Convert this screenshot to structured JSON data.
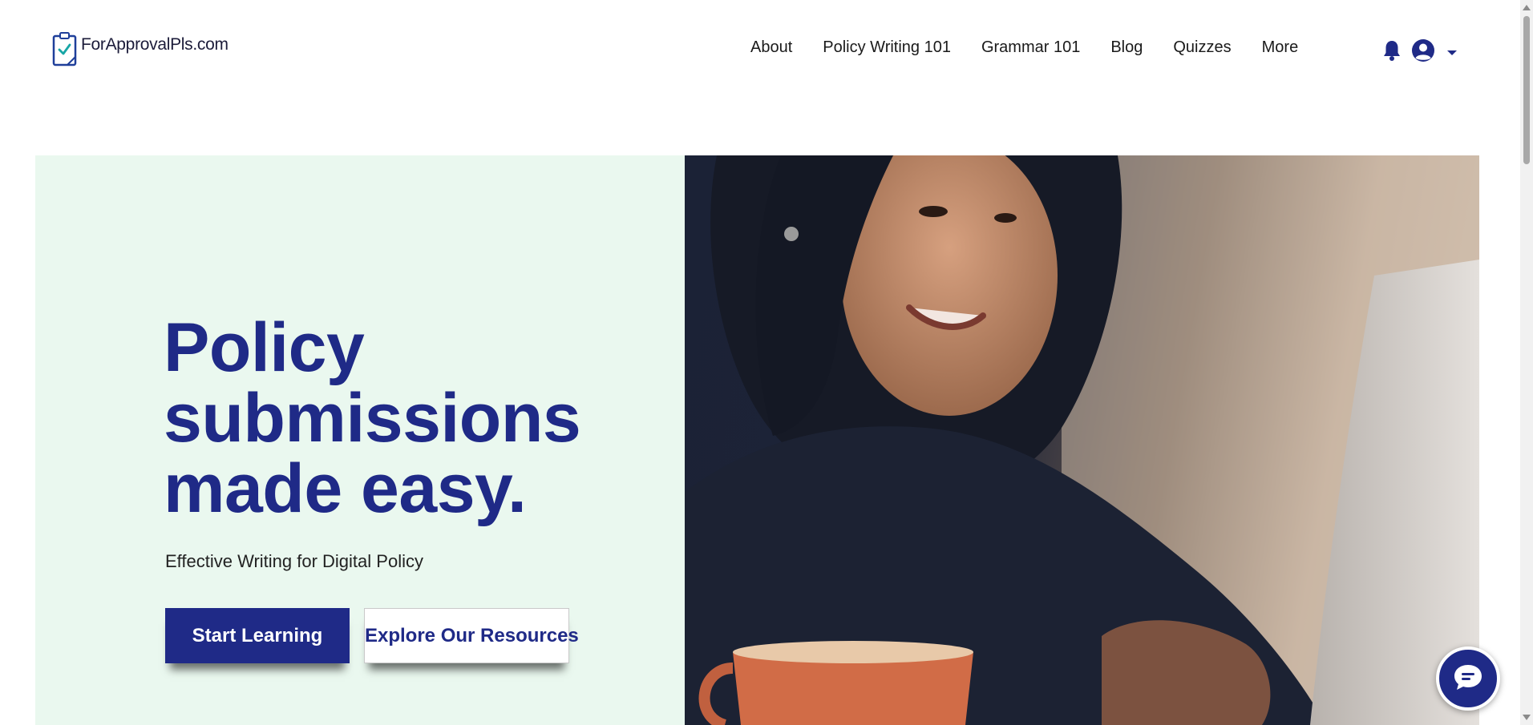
{
  "header": {
    "logo_text": "ForApprovalPls.com",
    "logo_icon": "clipboard-check-icon",
    "nav": [
      {
        "label": "About"
      },
      {
        "label": "Policy Writing 101"
      },
      {
        "label": "Grammar 101"
      },
      {
        "label": "Blog"
      },
      {
        "label": "Quizzes"
      },
      {
        "label": "More"
      }
    ],
    "icons": [
      "bell-icon",
      "user-avatar-icon",
      "caret-down-icon"
    ]
  },
  "hero": {
    "title_lines": [
      "Policy",
      "submissions",
      "made easy."
    ],
    "subtitle": "Effective Writing for Digital Policy",
    "primary_button": "Start Learning",
    "secondary_button": "Explore Our Resources",
    "image_description_icon": "hero-photo"
  },
  "chat": {
    "icon": "chat-bubble-icon"
  },
  "colors": {
    "brand": "#1f2a87",
    "hero_background": "#eaf8ef",
    "text": "#1a1a1a"
  }
}
